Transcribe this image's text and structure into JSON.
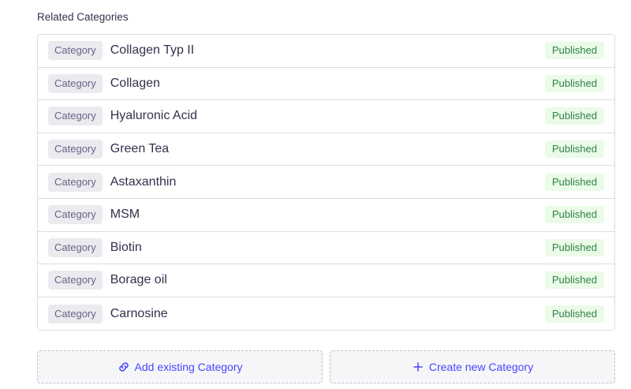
{
  "section": {
    "title": "Related Categories"
  },
  "relations": [
    {
      "type": "Category",
      "name": "Collagen Typ II",
      "status": "Published"
    },
    {
      "type": "Category",
      "name": "Collagen",
      "status": "Published"
    },
    {
      "type": "Category",
      "name": "Hyaluronic Acid",
      "status": "Published"
    },
    {
      "type": "Category",
      "name": "Green Tea",
      "status": "Published"
    },
    {
      "type": "Category",
      "name": "Astaxanthin",
      "status": "Published"
    },
    {
      "type": "Category",
      "name": "MSM",
      "status": "Published"
    },
    {
      "type": "Category",
      "name": "Biotin",
      "status": "Published"
    },
    {
      "type": "Category",
      "name": "Borage oil",
      "status": "Published"
    },
    {
      "type": "Category",
      "name": "Carnosine",
      "status": "Published"
    }
  ],
  "actions": {
    "add_existing": {
      "label": "Add existing Category",
      "icon": "link-icon"
    },
    "create_new": {
      "label": "Create new Category",
      "icon": "plus-icon"
    }
  },
  "colors": {
    "accent": "#4945ff",
    "published_text": "#328048",
    "published_bg": "#eafbe7",
    "tag_bg": "#eaeaef",
    "border": "#dcdce4"
  }
}
